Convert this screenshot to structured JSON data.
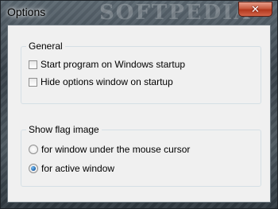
{
  "window": {
    "title": "Options",
    "watermark": "SOFTPEDIA",
    "close_glyph": "✕"
  },
  "general": {
    "title": "General",
    "options": [
      {
        "label": "Start program on Windows startup",
        "checked": false
      },
      {
        "label": "Hide options window on startup",
        "checked": false
      }
    ]
  },
  "flag": {
    "title": "Show flag image",
    "options": [
      {
        "label": "for window under the mouse cursor",
        "selected": false
      },
      {
        "label": "for active window",
        "selected": true
      }
    ]
  },
  "colors": {
    "close_button": "#c85b40",
    "radio_dot": "#1a5fa8",
    "client_background": "#f0f0f0"
  }
}
